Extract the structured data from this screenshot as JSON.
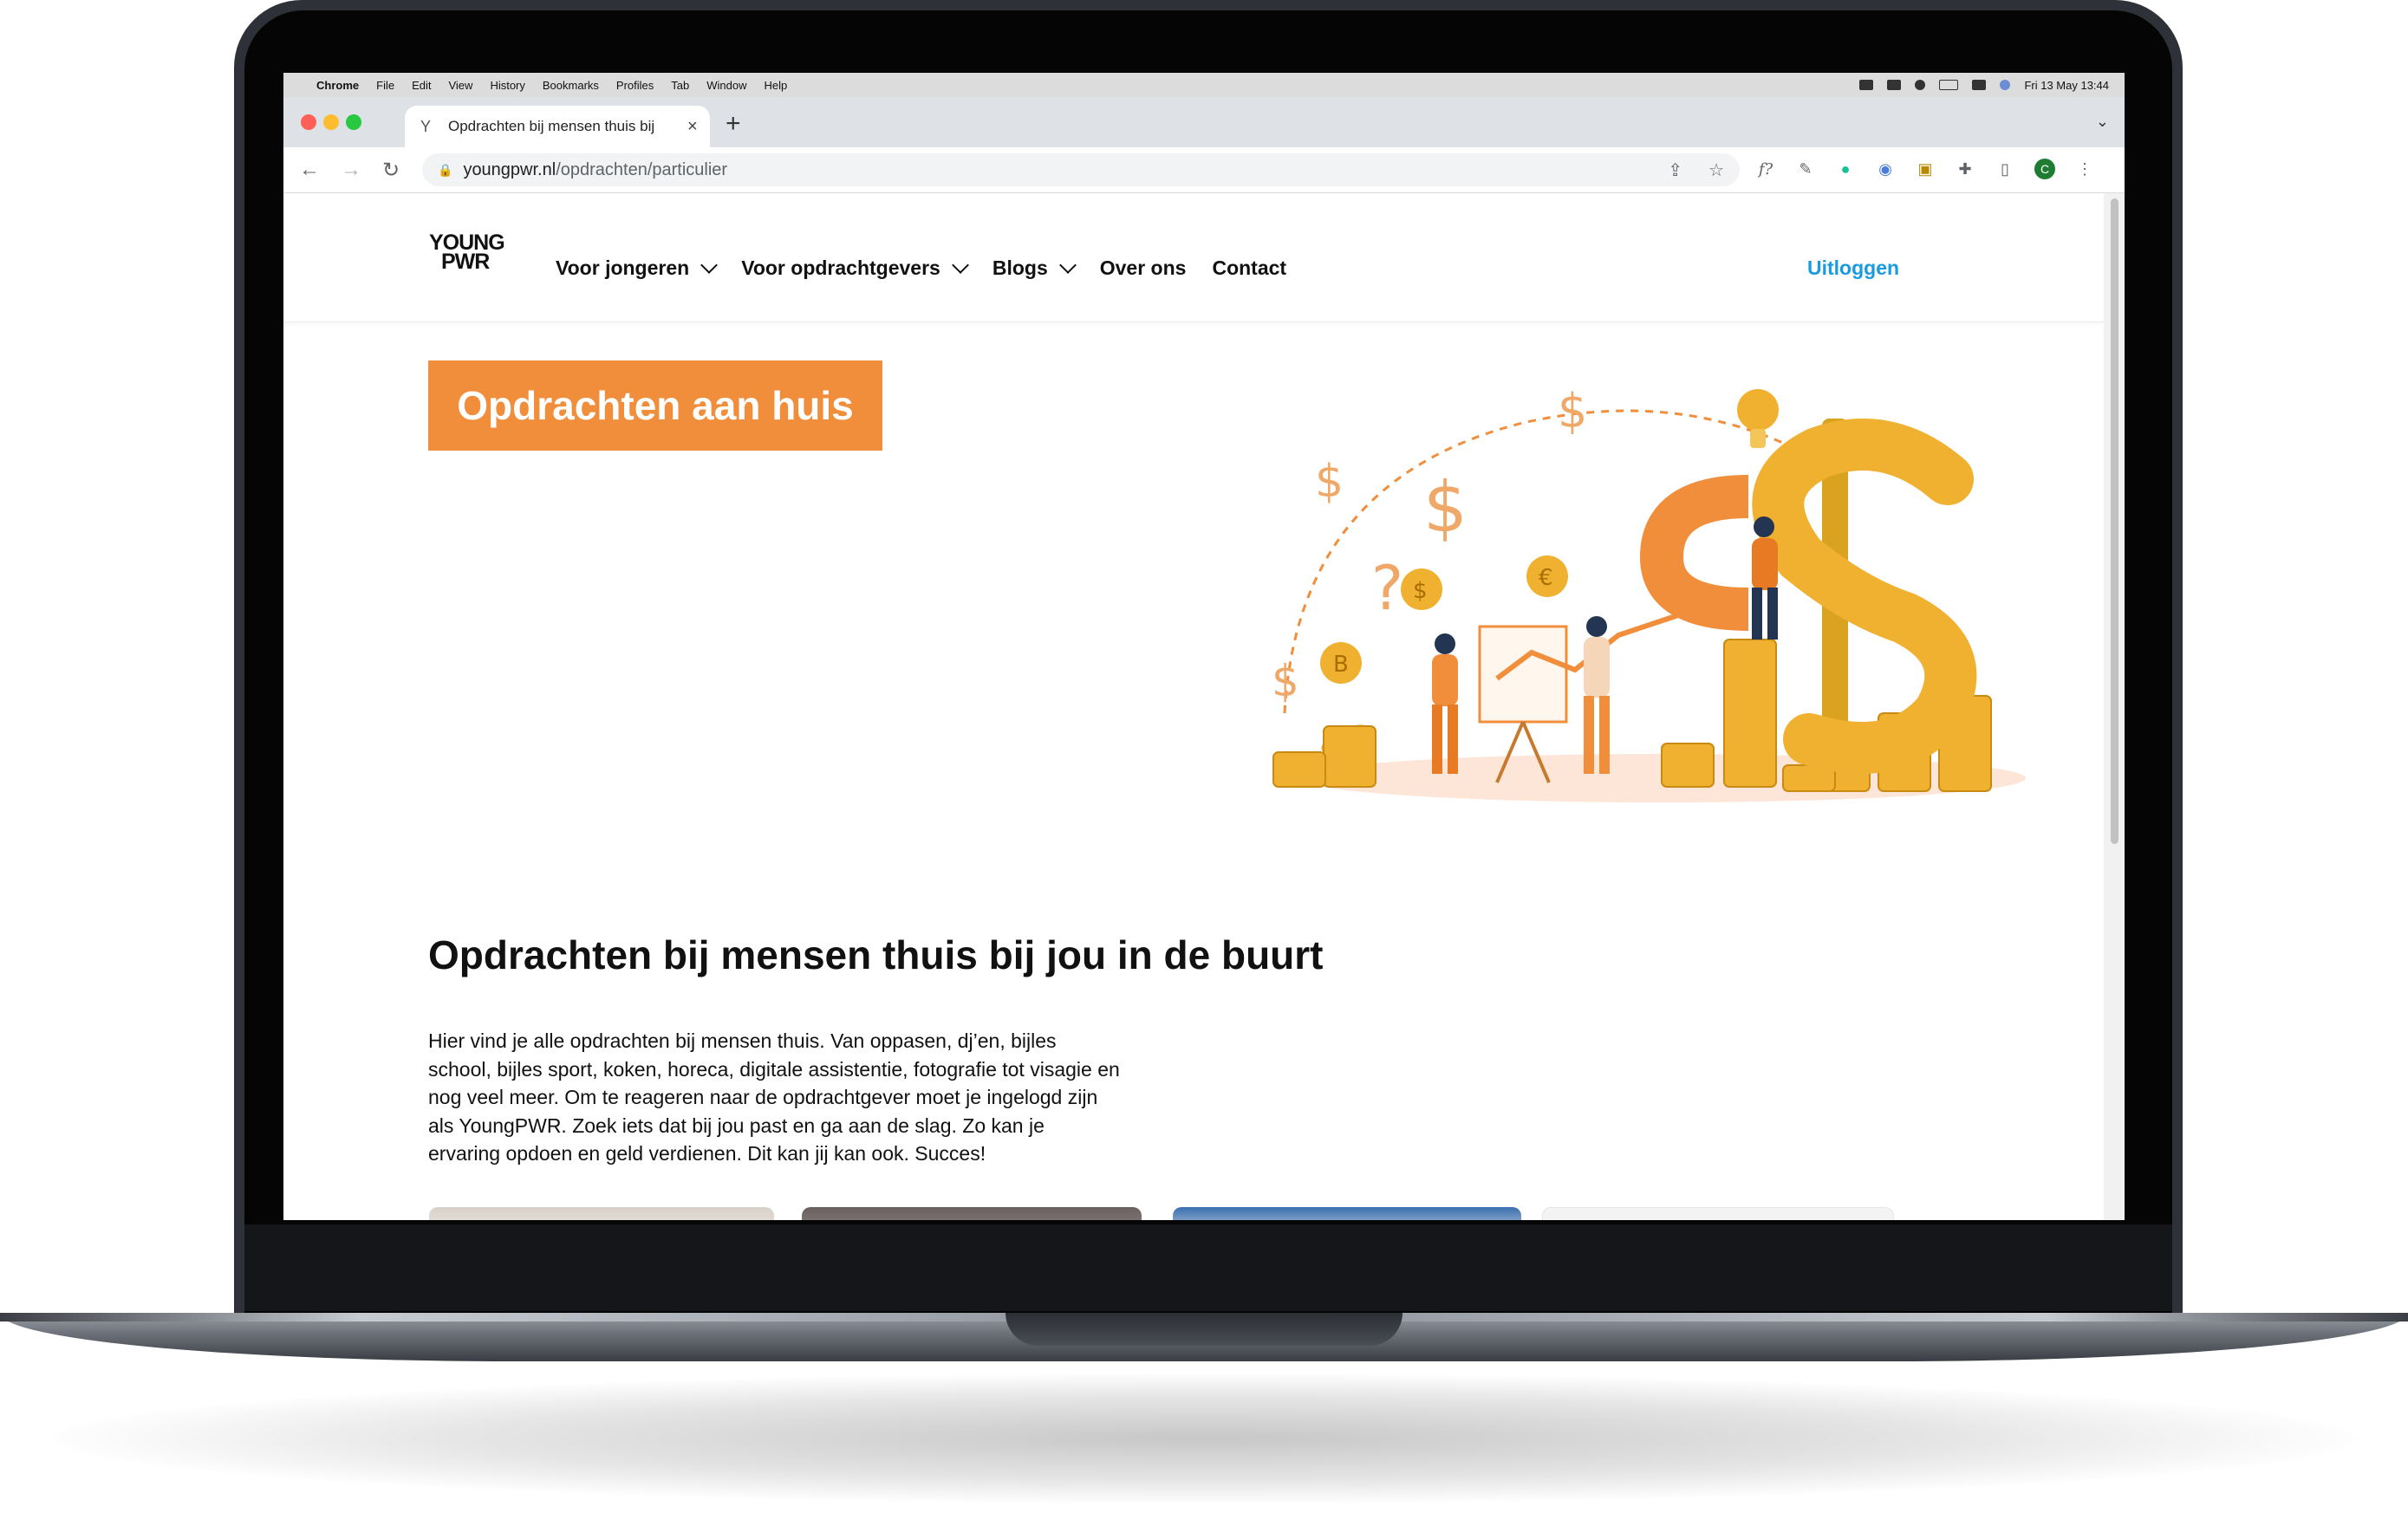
{
  "menubar": {
    "app": "Chrome",
    "items": [
      "File",
      "Edit",
      "View",
      "History",
      "Bookmarks",
      "Profiles",
      "Tab",
      "Window",
      "Help"
    ],
    "clock": "Fri 13 May  13:44"
  },
  "browser": {
    "tab_title": "Opdrachten bij mensen thuis bij",
    "url_domain": "youngpwr.nl",
    "url_path": "/opdrachten/particulier",
    "profile_initial": "C",
    "traffic_light_colors": [
      "#ff5f57",
      "#febc2e",
      "#28c840"
    ]
  },
  "site": {
    "logo_line1": "YOUNG",
    "logo_line2": "PWR",
    "nav": [
      {
        "label": "Voor jongeren",
        "dropdown": true
      },
      {
        "label": "Voor opdrachtgevers",
        "dropdown": true
      },
      {
        "label": "Blogs",
        "dropdown": true
      },
      {
        "label": "Over ons",
        "dropdown": false
      },
      {
        "label": "Contact",
        "dropdown": false
      }
    ],
    "logout_label": "Uitloggen",
    "accent_color": "#f18e3b",
    "link_color": "#1a9be0"
  },
  "hero": {
    "cta_label": "Opdrachten aan huis",
    "heading": "Opdrachten bij mensen thuis bij jou in de buurt",
    "intro": "Hier vind je alle opdrachten bij mensen thuis. Van oppasen, dj’en, bijles school, bijles sport, koken, horeca, digitale assistentie, fotografie tot visagie en nog veel meer. Om te reageren naar de opdrachtgever moet je ingelogd zijn als YoungPWR. Zoek iets dat bij jou past en ga aan de slag. Zo kan je ervaring opdoen en geld verdienen. Dit kan jij kan ook. Succes!"
  }
}
